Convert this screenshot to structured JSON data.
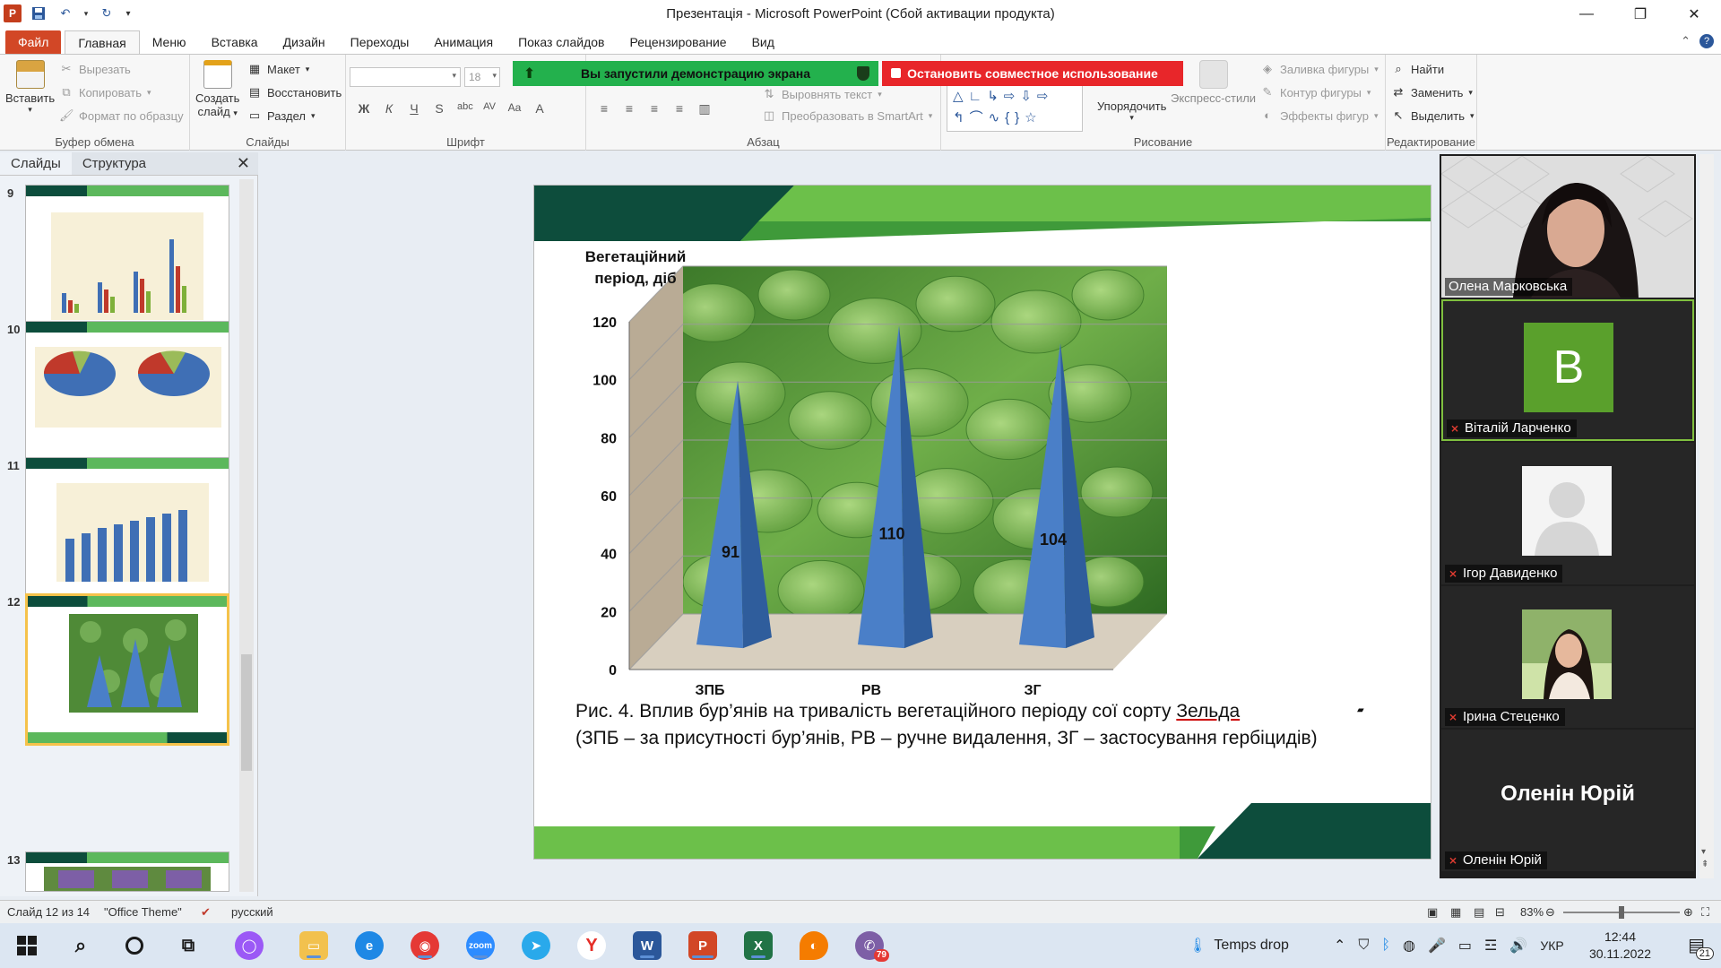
{
  "window": {
    "title": "Презентація  -  Microsoft PowerPoint (Сбой активации продукта)"
  },
  "ribbon_tabs": [
    {
      "label": "Файл"
    },
    {
      "label": "Главная"
    },
    {
      "label": "Меню"
    },
    {
      "label": "Вставка"
    },
    {
      "label": "Дизайн"
    },
    {
      "label": "Переходы"
    },
    {
      "label": "Анимация"
    },
    {
      "label": "Показ слайдов"
    },
    {
      "label": "Рецензирование"
    },
    {
      "label": "Вид"
    }
  ],
  "ribbon": {
    "clipboard": {
      "paste": "Вставить",
      "cut": "Вырезать",
      "copy": "Копировать",
      "format_painter": "Формат по образцу",
      "label": "Буфер обмена"
    },
    "slides": {
      "new_slide_1": "Создать",
      "new_slide_2": "слайд",
      "layout": "Макет",
      "reset": "Восстановить",
      "section": "Раздел",
      "label": "Слайды"
    },
    "font": {
      "size": "18",
      "label": "Шрифт"
    },
    "paragraph": {
      "align_text": "Выровнять текст",
      "smartart": "Преобразовать в SmartArt",
      "label": "Абзац"
    },
    "drawing": {
      "arrange": "Упорядочить",
      "quick_styles": "Экспресс-стили",
      "fill": "Заливка фигуры",
      "outline": "Контур фигуры",
      "effects": "Эффекты фигур",
      "label": "Рисование"
    },
    "editing": {
      "find": "Найти",
      "replace": "Заменить",
      "select": "Выделить",
      "label": "Редактирование"
    }
  },
  "share_banner": {
    "started": "Вы запустили демонстрацию экрана",
    "stop": "Остановить совместное использование"
  },
  "slide_panel": {
    "tab_slides": "Слайды",
    "tab_outline": "Структура",
    "thumbs": [
      {
        "num": "9"
      },
      {
        "num": "10"
      },
      {
        "num": "11"
      },
      {
        "num": "12"
      },
      {
        "num": "13"
      }
    ]
  },
  "slide": {
    "caption_line1_a": "Рис. 4. Вплив бур’янів на тривалість вегетаційного періоду сої сорту ",
    "caption_line1_b": "Зельда",
    "caption_line2": "(ЗПБ – за присутності бур’янів, РВ – ручне видалення, ЗГ – застосування гербіцидів)"
  },
  "chart_data": {
    "type": "bar",
    "categories": [
      "ЗПБ",
      "РВ",
      "ЗГ"
    ],
    "values": [
      91,
      110,
      104
    ],
    "ylabel": "Вегетаційний період, діб",
    "ylim": [
      0,
      120
    ],
    "yticks": [
      0,
      20,
      40,
      60,
      80,
      100,
      120
    ],
    "bar_color": "#4a7fc8",
    "grid": true
  },
  "participants": [
    {
      "name": "Олена Марковська",
      "muted": false
    },
    {
      "name": "Віталій Ларченко",
      "initial": "B",
      "muted": true
    },
    {
      "name": "Ігор Давиденко",
      "muted": true
    },
    {
      "name": "Ірина Стеценко",
      "muted": true
    },
    {
      "name": "Оленін Юрій",
      "muted": true,
      "display": "Оленін Юрій"
    }
  ],
  "statusbar": {
    "slide_info": "Слайд 12 из 14",
    "theme": "\"Office Theme\"",
    "language": "русский",
    "zoom": "83%"
  },
  "taskbar": {
    "weather": "Temps drop",
    "lang": "УКР",
    "time": "12:44",
    "date": "30.11.2022",
    "notifications": "21",
    "viber_badge": "79"
  }
}
